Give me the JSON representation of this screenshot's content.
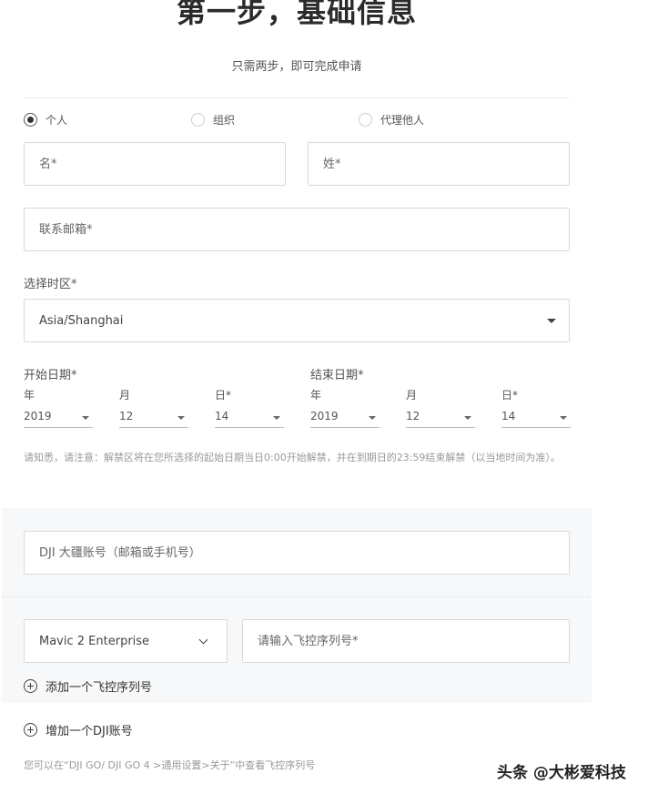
{
  "header": {
    "title": "第一步，基础信息",
    "subtitle": "只需两步，即可完成申请"
  },
  "applicant_type": {
    "options": [
      {
        "label": "个人",
        "selected": true
      },
      {
        "label": "组织",
        "selected": false
      },
      {
        "label": "代理他人",
        "selected": false
      }
    ]
  },
  "form": {
    "first_name_placeholder": "名*",
    "last_name_placeholder": "姓*",
    "email_placeholder": "联系邮箱*",
    "timezone_label": "选择时区*",
    "timezone_value": "Asia/Shanghai"
  },
  "start_date": {
    "label": "开始日期*",
    "year_label": "年",
    "year_value": "2019",
    "month_label": "月",
    "month_value": "12",
    "day_label": "日*",
    "day_value": "14"
  },
  "end_date": {
    "label": "结束日期*",
    "year_label": "年",
    "year_value": "2019",
    "month_label": "月",
    "month_value": "12",
    "day_label": "日*",
    "day_value": "14"
  },
  "notice": "请知悉，请注意：解禁区将在您所选择的起始日期当日0:00开始解禁，并在到期日的23:59结束解禁（以当地时间为准）。",
  "account_panel": {
    "account_placeholder": "DJI 大疆账号（邮箱或手机号）",
    "model_value": "Mavic 2 Enterprise",
    "serial_placeholder": "请输入飞控序列号*",
    "add_serial_label": "添加一个飞控序列号"
  },
  "add_account_label": "增加一个DJI账号",
  "hint": "您可以在“DJI GO/ DJI GO 4 >通用设置>关于”中查看飞控序列号",
  "watermark": "头条 @大彬爱科技",
  "colors": {
    "text": "#333333",
    "muted": "#999999",
    "border": "#d9d9d9",
    "panel_bg": "#f7f8fa"
  }
}
